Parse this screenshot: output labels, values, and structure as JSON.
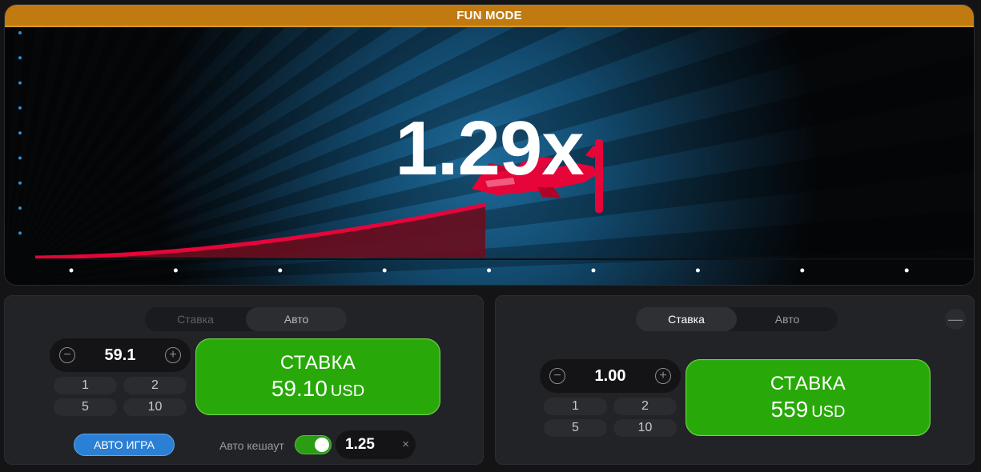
{
  "header": {
    "mode_label": "FUN MODE"
  },
  "game": {
    "multiplier": "1.29x",
    "accent_color": "#e50539",
    "banner_color": "#c07a10"
  },
  "panel_left": {
    "tabs": [
      {
        "label": "Ставка",
        "active": false
      },
      {
        "label": "Авто",
        "active": true
      }
    ],
    "stepper": {
      "value": "59.1"
    },
    "chips": [
      "1",
      "2",
      "5",
      "10"
    ],
    "bet_button": {
      "title": "СТАВКА",
      "amount": "59.10",
      "currency": "USD"
    },
    "auto_play_label": "АВТО ИГРА",
    "auto_cashout": {
      "label": "Авто кешаут",
      "enabled": true,
      "value": "1.25",
      "clear_icon": "×"
    }
  },
  "panel_right": {
    "tabs": [
      {
        "label": "Ставка",
        "active": true
      },
      {
        "label": "Авто",
        "active": false
      }
    ],
    "stepper": {
      "value": "1.00"
    },
    "chips": [
      "1",
      "2",
      "5",
      "10"
    ],
    "bet_button": {
      "title": "СТАВКА",
      "amount": "559",
      "currency": "USD"
    },
    "remove_icon": "minus-icon"
  }
}
